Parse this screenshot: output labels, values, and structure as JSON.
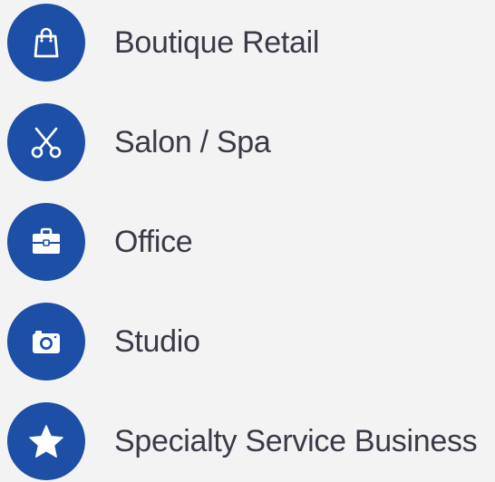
{
  "items": [
    {
      "icon": "shopping-bag-icon",
      "label": "Boutique Retail"
    },
    {
      "icon": "scissors-icon",
      "label": "Salon / Spa"
    },
    {
      "icon": "briefcase-icon",
      "label": "Office"
    },
    {
      "icon": "camera-icon",
      "label": "Studio"
    },
    {
      "icon": "star-icon",
      "label": "Specialty Service Business"
    }
  ],
  "colors": {
    "accent": "#1d4fa6",
    "text": "#3a3a48",
    "background": "#f3f3f3"
  }
}
